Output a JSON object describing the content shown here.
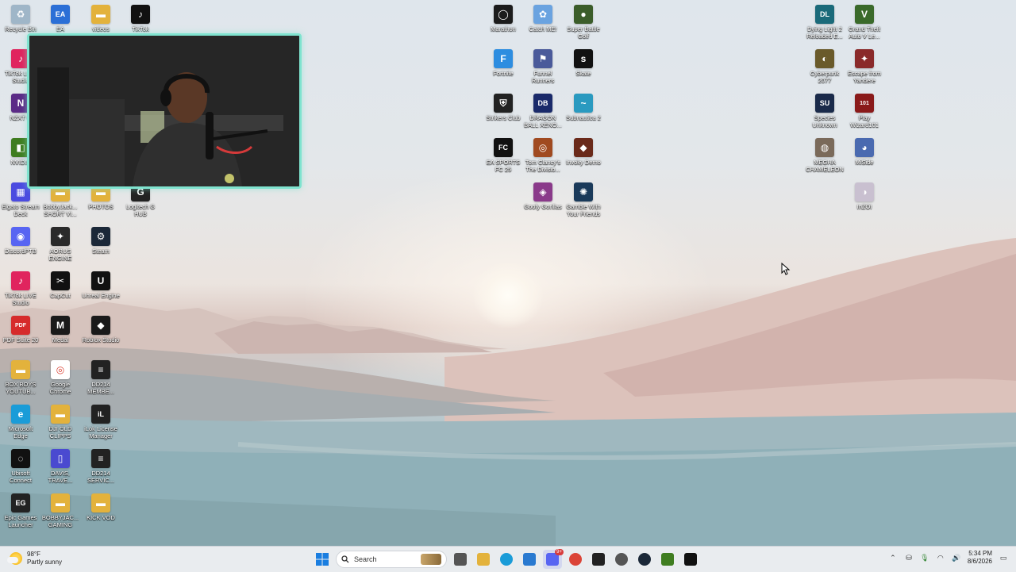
{
  "desktop": {
    "icons_left": [
      {
        "label": "Recycle Bin",
        "color": "#9fb6c8",
        "glyph": "♻"
      },
      {
        "label": "EA",
        "color": "#2b6fd6",
        "glyph": "EA"
      },
      {
        "label": "videos",
        "color": "#e3b23c",
        "glyph": "▬"
      },
      {
        "label": "TikTok",
        "color": "#111111",
        "glyph": "♪"
      },
      {
        "label": "TikTok LIVE Studio",
        "color": "#e0245e",
        "glyph": "♪"
      },
      {
        "label": "NZXT C",
        "color": "#5b2b86",
        "glyph": "N"
      },
      {
        "label": "NVIDIA",
        "color": "#3f7d20",
        "glyph": "◧"
      },
      {
        "label": "Elgato Stream Deck",
        "color": "#4b4be0",
        "glyph": "▦"
      },
      {
        "label": "BobbyJack... SHORT VI...",
        "color": "#e3b23c",
        "glyph": "▬"
      },
      {
        "label": "PHOTOS",
        "color": "#e3b23c",
        "glyph": "▬"
      },
      {
        "label": "Logitech G HUB",
        "color": "#222222",
        "glyph": "G"
      },
      {
        "label": "DiscordPTB",
        "color": "#5865f2",
        "glyph": "◉"
      },
      {
        "label": "AORUS ENGINE",
        "color": "#2a2a2a",
        "glyph": "✦"
      },
      {
        "label": "Steam",
        "color": "#1b2838",
        "glyph": "⚙"
      },
      {
        "label": "TikTok LIVE Studio",
        "color": "#e0245e",
        "glyph": "♪"
      },
      {
        "label": "CapCut",
        "color": "#111111",
        "glyph": "✂"
      },
      {
        "label": "Unreal Engine",
        "color": "#111111",
        "glyph": "U"
      },
      {
        "label": "PDF Suite 20",
        "color": "#d62b2b",
        "glyph": "PDF"
      },
      {
        "label": "Medal",
        "color": "#1a1a1a",
        "glyph": "M"
      },
      {
        "label": "Roblox Studio",
        "color": "#1a1a1a",
        "glyph": "◆"
      },
      {
        "label": "BOX BOYS YOUTUB...",
        "color": "#e3b23c",
        "glyph": "▬"
      },
      {
        "label": "Google Chrome",
        "color": "#ffffff",
        "glyph": "◎"
      },
      {
        "label": "DD214 MEMBE...",
        "color": "#222222",
        "glyph": "≡"
      },
      {
        "label": "Microsoft Edge",
        "color": "#1a9cd8",
        "glyph": "e"
      },
      {
        "label": "DJI OLD CLIPPS",
        "color": "#e3b23c",
        "glyph": "▬"
      },
      {
        "label": "iLok License Manager",
        "color": "#222222",
        "glyph": "iL"
      },
      {
        "label": "Ubisoft Connect",
        "color": "#111111",
        "glyph": "◌"
      },
      {
        "label": "DAVIS, TRAVE...",
        "color": "#4a4ad0",
        "glyph": "▯"
      },
      {
        "label": "DD214 SERVIC...",
        "color": "#222222",
        "glyph": "≡"
      },
      {
        "label": "Epic Games Launcher",
        "color": "#222222",
        "glyph": "EG"
      },
      {
        "label": "BOBBYJAC... GAMING",
        "color": "#e3b23c",
        "glyph": "▬"
      },
      {
        "label": "KICK VOD",
        "color": "#e3b23c",
        "glyph": "▬"
      }
    ],
    "icons_middle": [
      {
        "label": "Marathon",
        "color": "#1c1c1c",
        "glyph": "◯"
      },
      {
        "label": "Catch ME!",
        "color": "#6aa3e0",
        "glyph": "✿"
      },
      {
        "label": "Super Battle Golf",
        "color": "#3b5d2a",
        "glyph": "●"
      },
      {
        "label": "Fortnite",
        "color": "#2d8de0",
        "glyph": "F"
      },
      {
        "label": "Funnel Runners",
        "color": "#4a5a9a",
        "glyph": "⚑"
      },
      {
        "label": "Skate",
        "color": "#111111",
        "glyph": "s"
      },
      {
        "label": "Strikers Club",
        "color": "#222222",
        "glyph": "⛨"
      },
      {
        "label": "DRAGON BALL XENO...",
        "color": "#1a2a6a",
        "glyph": "DB"
      },
      {
        "label": "Subnautica 2",
        "color": "#2a9ac0",
        "glyph": "~"
      },
      {
        "label": "EA SPORTS FC 25",
        "color": "#111111",
        "glyph": "FC"
      },
      {
        "label": "Tom Clancy's The Divisio...",
        "color": "#a04a20",
        "glyph": "◎"
      },
      {
        "label": "Invoky Demo",
        "color": "#6a2a1a",
        "glyph": "◆"
      },
      {
        "label": "Goofy Gorillas",
        "color": "#8a3a8a",
        "glyph": "◈"
      },
      {
        "label": "Gamble With Your Friends",
        "color": "#1a3a5a",
        "glyph": "✺"
      }
    ],
    "icons_right": [
      {
        "label": "Dying Light 2 Reloaded E...",
        "color": "#1a6a7a",
        "glyph": "DL"
      },
      {
        "label": "Grand Theft Auto V Le...",
        "color": "#3a6a2a",
        "glyph": "V"
      },
      {
        "label": "Cyberpunk 2077",
        "color": "#6a5a2a",
        "glyph": "◐"
      },
      {
        "label": "Escape from Yandere",
        "color": "#8a2a2a",
        "glyph": "✦"
      },
      {
        "label": "Species Unknown",
        "color": "#1a2a4a",
        "glyph": "SU"
      },
      {
        "label": "Play Wizard101",
        "color": "#8a1a1a",
        "glyph": "101"
      },
      {
        "label": "MEGHA CHAMELEON",
        "color": "#7a6a5a",
        "glyph": "◍"
      },
      {
        "label": "MiSide",
        "color": "#4a6ab0",
        "glyph": "◕"
      },
      {
        "label": "InZOI",
        "color": "#c9c0d0",
        "glyph": "◑"
      }
    ]
  },
  "taskbar": {
    "weather_temp": "98°F",
    "weather_desc": "Partly sunny",
    "search_placeholder": "Search",
    "pinned": [
      {
        "name": "start-button",
        "icon": "windows-icon",
        "color": "#1a7ee0"
      },
      {
        "name": "task-view-button",
        "icon": "task-view-icon",
        "color": "#555"
      },
      {
        "name": "file-explorer-button",
        "icon": "folder-icon",
        "color": "#e3b23c"
      },
      {
        "name": "edge-button",
        "icon": "edge-icon",
        "color": "#1a9cd8"
      },
      {
        "name": "store-button",
        "icon": "store-icon",
        "color": "#2a7ad0"
      },
      {
        "name": "discord-button",
        "icon": "discord-icon",
        "color": "#5865f2"
      },
      {
        "name": "chrome-button",
        "icon": "chrome-icon",
        "color": "#db4437"
      },
      {
        "name": "obs-button",
        "icon": "obs-icon",
        "color": "#222"
      },
      {
        "name": "settings-button",
        "icon": "gear-icon",
        "color": "#555"
      },
      {
        "name": "steam-button",
        "icon": "steam-icon",
        "color": "#1b2838"
      },
      {
        "name": "nvidia-button",
        "icon": "nvidia-icon",
        "color": "#3f7d20"
      },
      {
        "name": "capcut-button",
        "icon": "capcut-icon",
        "color": "#111"
      }
    ],
    "discord_badge": "9+",
    "time": "5:34 PM",
    "date": "8/6/2026"
  }
}
